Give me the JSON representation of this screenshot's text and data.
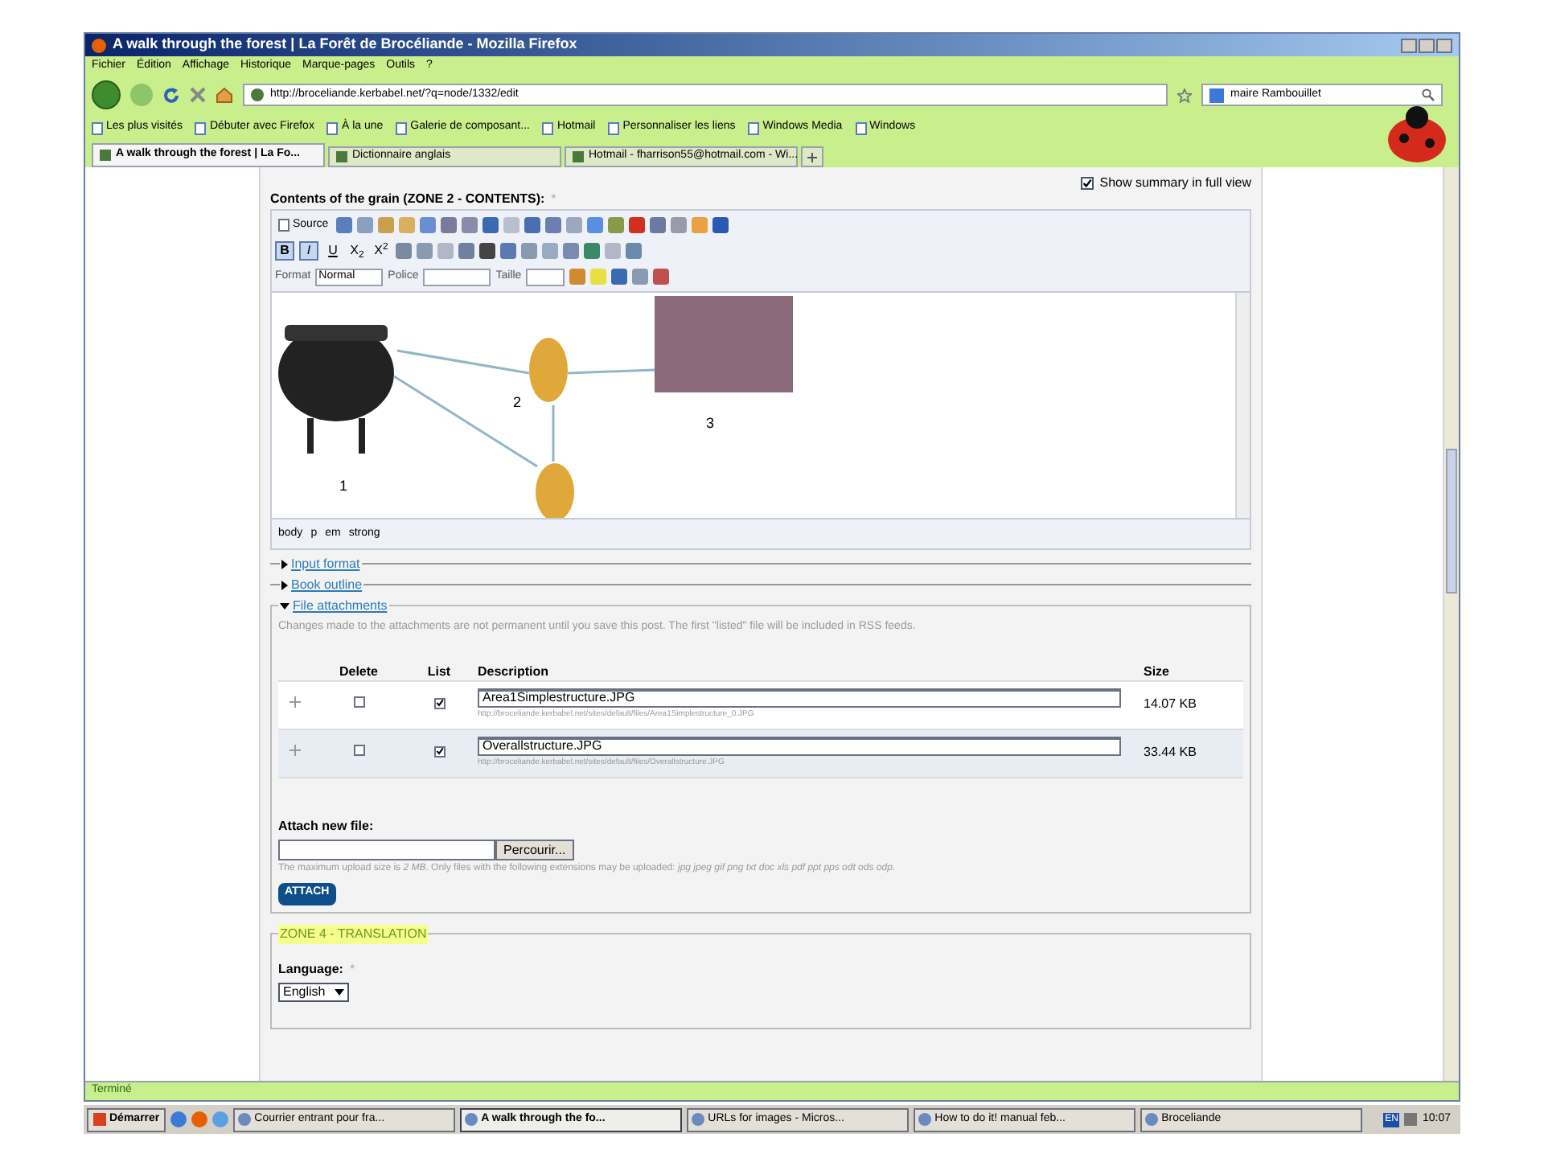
{
  "window": {
    "title": "A walk through the forest | La Forêt de Brocéliande - Mozilla Firefox"
  },
  "menu": [
    "Fichier",
    "Édition",
    "Affichage",
    "Historique",
    "Marque-pages",
    "Outils",
    "?"
  ],
  "address": {
    "value": "http://broceliande.kerbabel.net/?q=node/1332/edit"
  },
  "search": {
    "value": "maire Rambouillet"
  },
  "bookmarks": [
    "Les plus visités",
    "Débuter avec Firefox",
    "À la une",
    "Galerie de composant...",
    "Hotmail",
    "Personnaliser les liens",
    "Windows Media",
    "Windows"
  ],
  "tabs": [
    {
      "label": "A walk through the forest | La Fo...",
      "selected": true
    },
    {
      "label": "Dictionnaire anglais",
      "selected": false
    },
    {
      "label": "Hotmail - fharrison55@hotmail.com - Wi...",
      "selected": false
    }
  ],
  "show_summary": {
    "label": "Show summary in full view",
    "checked": true
  },
  "editor": {
    "label": "Contents of the grain (ZONE 2 - CONTENTS):",
    "required_mark": "*",
    "source_button": "Source",
    "style_buttons": [
      {
        "label": "B",
        "selected": true
      },
      {
        "label": "I",
        "selected": true
      },
      {
        "label": "U",
        "selected": false
      },
      {
        "label": "X$_{2}$",
        "selected": false
      },
      {
        "label": "X$^{2}$",
        "selected": false
      }
    ],
    "format_label": "Format",
    "format_value": "Normal",
    "font_label": "Police",
    "size_label": "Taille",
    "figure_labels": [
      "1",
      "2",
      "3"
    ],
    "path": [
      "body",
      "p",
      "em",
      "strong"
    ]
  },
  "collapsed": [
    {
      "label": "Input format",
      "expanded": false
    },
    {
      "label": "Book outline",
      "expanded": false
    }
  ],
  "attachments": {
    "legend": "File attachments",
    "expanded": true,
    "note": "Changes made to the attachments are not permanent until you save this post. The first \"listed\" file will be included in RSS feeds.",
    "columns": [
      "Delete",
      "List",
      "Description",
      "Size"
    ],
    "rows": [
      {
        "delete": false,
        "list": true,
        "description": "Area1Simplestructure.JPG",
        "url": "http://broceliande.kerbabel.net/sites/default/files/Area1Simplestructure_0.JPG",
        "size": "14.07 KB"
      },
      {
        "delete": false,
        "list": true,
        "description": "Overallstructure.JPG",
        "url": "http://broceliande.kerbabel.net/sites/default/files/Overallstructure.JPG",
        "size": "33.44 KB"
      }
    ],
    "new_file_label": "Attach new file:",
    "browse_button": "Percourir...",
    "upload_note": "The maximum upload size is *2 MB*. Only files with the following extensions may be uploaded: *jpg jpeg gif png txt doc xls pdf ppt pps odt ods odp*.",
    "attach_button": "ATTACH"
  },
  "zone4": {
    "legend": "ZONE 4 - TRANSLATION",
    "language_label": "Language:",
    "required_mark": "*",
    "language_value": "English"
  },
  "status_bar": "Terminé",
  "taskbar": {
    "start": "Démarrer",
    "items": [
      {
        "label": "Courrier entrant pour fra...",
        "selected": false
      },
      {
        "label": "A walk through the fo...",
        "selected": true
      },
      {
        "label": "URLs for images - Micros...",
        "selected": false
      },
      {
        "label": "How to do it! manual feb...",
        "selected": false
      },
      {
        "label": "Broceliande",
        "selected": false
      }
    ],
    "language": "EN",
    "clock": "10:07"
  }
}
